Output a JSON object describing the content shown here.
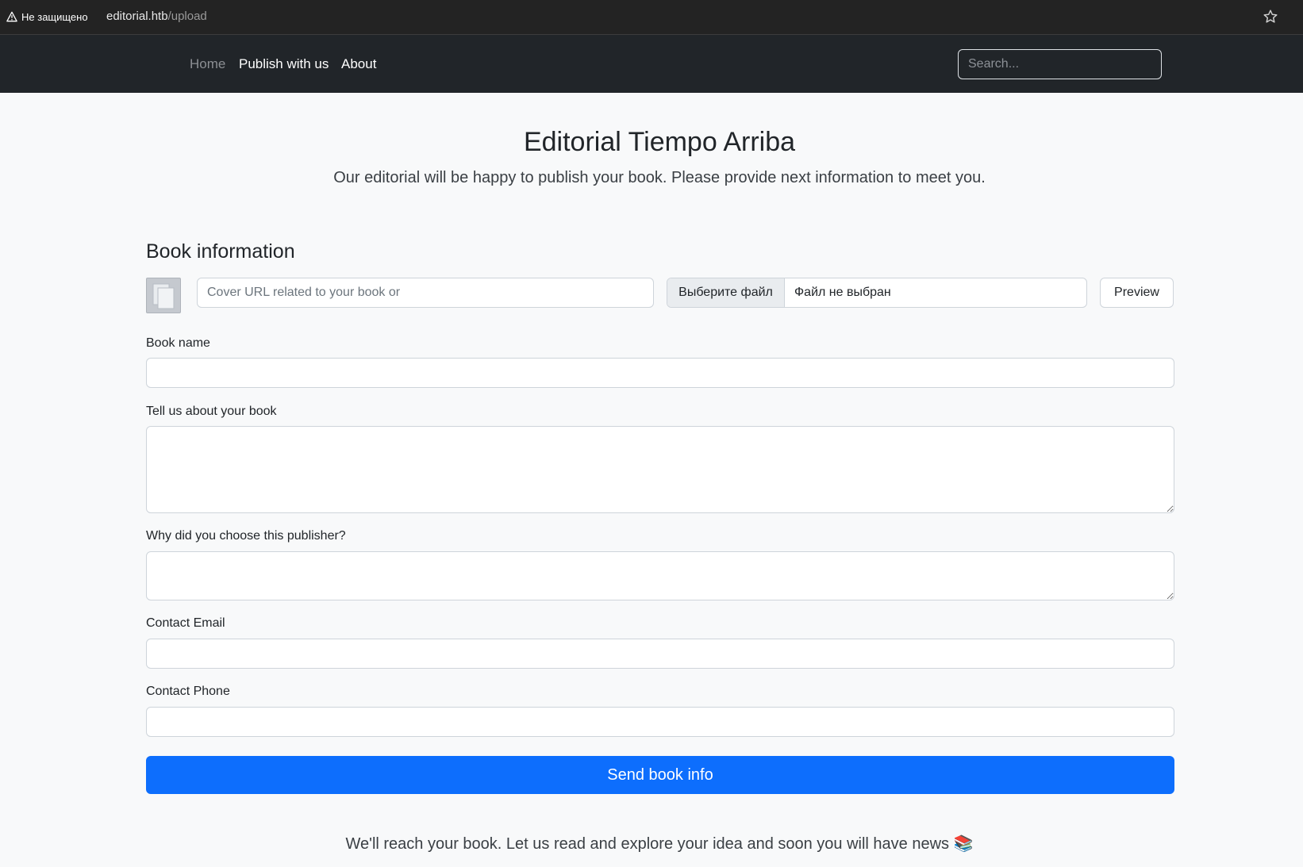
{
  "browser": {
    "security_label": "Не защищено",
    "url_host": "editorial.htb",
    "url_path": "/upload"
  },
  "navbar": {
    "items": [
      {
        "label": "Home",
        "active": false
      },
      {
        "label": "Publish with us",
        "active": true
      },
      {
        "label": "About",
        "active": true
      }
    ],
    "search_placeholder": "Search..."
  },
  "header": {
    "title": "Editorial Tiempo Arriba",
    "subtitle": "Our editorial will be happy to publish your book. Please provide next information to meet you."
  },
  "form": {
    "section_title": "Book information",
    "cover_url_placeholder": "Cover URL related to your book or",
    "file_button_label": "Выберите файл",
    "file_status": "Файл не выбран",
    "preview_label": "Preview",
    "book_name_label": "Book name",
    "about_label": "Tell us about your book",
    "publisher_label": "Why did you choose this publisher?",
    "email_label": "Contact Email",
    "phone_label": "Contact Phone",
    "submit_label": "Send book info"
  },
  "footer": {
    "note": "We'll reach your book. Let us read and explore your idea and soon you will have news 📚"
  }
}
